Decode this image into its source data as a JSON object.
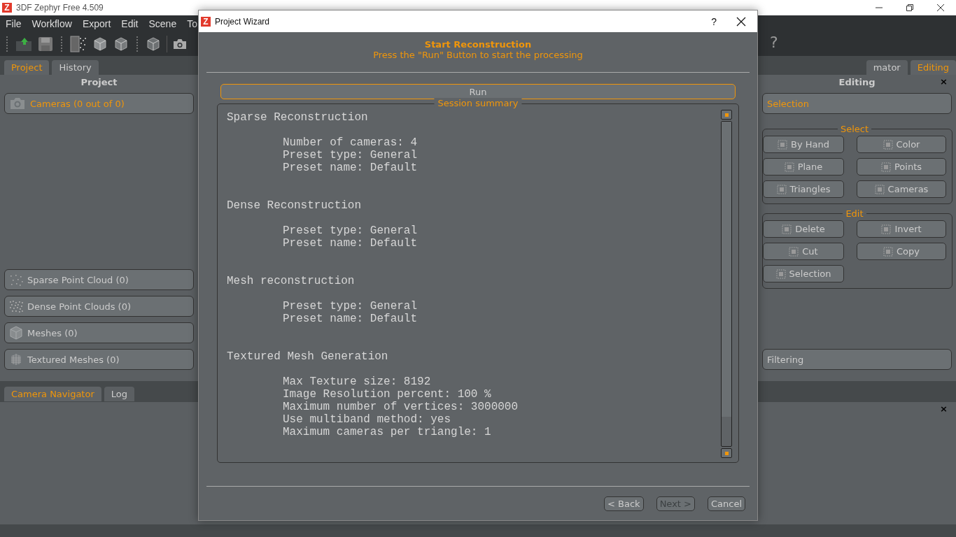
{
  "window": {
    "logo": "Z",
    "title": "3DF Zephyr Free 4.509"
  },
  "menu": [
    "File",
    "Workflow",
    "Export",
    "Edit",
    "Scene",
    "To"
  ],
  "toolbar": {
    "help": "?"
  },
  "left_panel": {
    "tabs": [
      {
        "label": "Project",
        "selected": true
      },
      {
        "label": "History",
        "selected": false
      }
    ],
    "title": "Project",
    "top_items": [
      {
        "kind": "camera",
        "label": "Cameras (0 out of 0)",
        "selected": true
      }
    ],
    "bottom_items": [
      {
        "kind": "sparse",
        "label": "Sparse Point Cloud (0)",
        "selected": false
      },
      {
        "kind": "dense",
        "label": "Dense Point Clouds (0)",
        "selected": false
      },
      {
        "kind": "mesh",
        "label": "Meshes (0)",
        "selected": false
      },
      {
        "kind": "textured",
        "label": "Textured Meshes (0)",
        "selected": false
      }
    ]
  },
  "right_panel": {
    "tabs": [
      {
        "label": "mator",
        "selected": false
      },
      {
        "label": "Editing",
        "selected": true
      }
    ],
    "title": "Editing",
    "close": "×",
    "top_item": {
      "label": "Selection"
    },
    "groups": [
      {
        "title": "Select",
        "buttons": [
          "By Hand",
          "Color",
          "Plane",
          "Points",
          "Triangles",
          "Cameras"
        ]
      },
      {
        "title": "Edit",
        "buttons": [
          "Delete",
          "Invert",
          "Cut",
          "Copy",
          "Selection"
        ]
      }
    ],
    "bottom_item": {
      "label": "Filtering"
    }
  },
  "bottom_panel": {
    "tabs": [
      {
        "label": "Camera Navigator",
        "selected": true
      },
      {
        "label": "Log",
        "selected": false
      }
    ],
    "close": "×"
  },
  "dialog": {
    "logo": "Z",
    "title": "Project Wizard",
    "help": "?",
    "heading": "Start Reconstruction",
    "subheading": "Press the \"Run\" Button to start the processing",
    "run_button": "Run",
    "summary": {
      "title": "Session summary",
      "sections": [
        {
          "heading": "Sparse Reconstruction",
          "lines": [
            "Number of cameras: 4",
            "Preset type: General",
            "Preset name: Default"
          ]
        },
        {
          "heading": "Dense Reconstruction",
          "lines": [
            "Preset type: General",
            "Preset name: Default"
          ]
        },
        {
          "heading": "Mesh reconstruction",
          "lines": [
            "Preset type: General",
            "Preset name: Default"
          ]
        },
        {
          "heading": "Textured Mesh Generation",
          "lines": [
            "Max Texture size: 8192",
            "Image Resolution percent: 100 %",
            "Maximum number of vertices: 3000000",
            "Use multiband method: yes",
            "Maximum cameras per triangle: 1"
          ]
        }
      ]
    },
    "buttons": [
      {
        "label": "< Back",
        "disabled": false
      },
      {
        "label": "Next >",
        "disabled": true
      },
      {
        "label": "Cancel",
        "disabled": false
      }
    ]
  }
}
